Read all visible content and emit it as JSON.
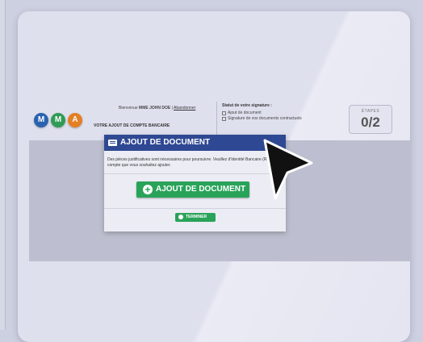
{
  "logo": {
    "letters": [
      "M",
      "M",
      "A"
    ],
    "colors": [
      "#2a63b0",
      "#2f9c56",
      "#e47f24"
    ]
  },
  "header": {
    "subtitle": "VOTRE AJOUT DE COMPTE BANCAIRE",
    "welcome_prefix": "Bienvenue",
    "user_name": "MME JOHN DOE",
    "separator": "|",
    "abandon_link": "Abandonner"
  },
  "status": {
    "title": "Statut de votre signature :",
    "items": [
      "Ajout de document",
      "Signature de vos documents contractuels"
    ]
  },
  "steps": {
    "label": "ÉTAPES",
    "value": "0/2"
  },
  "modal": {
    "title": "AJOUT DE DOCUMENT",
    "text": "Des pièces justificatives sont nécessaires pour poursuivre. Veuillez d'Identité Bancaire (RIB) du compte que vous souhaitez ajouter.",
    "add_button": "AJOUT DE DOCUMENT",
    "end_button": "TERMINER"
  },
  "colors": {
    "primary_blue": "#2e4893",
    "success_green": "#29a35a"
  }
}
